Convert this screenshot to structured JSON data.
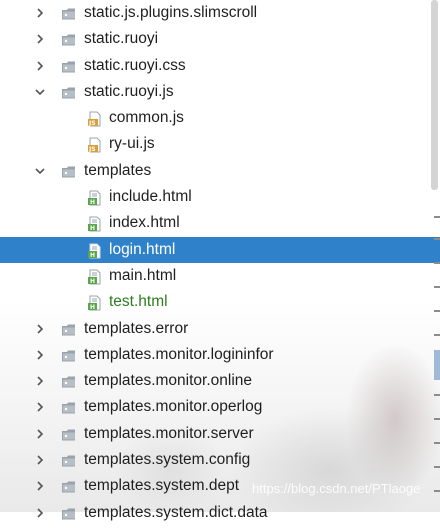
{
  "tree": {
    "rows": [
      {
        "label": "static.js.plugins.slimscroll",
        "type": "folder",
        "state": "collapsed"
      },
      {
        "label": "static.ruoyi",
        "type": "folder",
        "state": "collapsed"
      },
      {
        "label": "static.ruoyi.css",
        "type": "folder",
        "state": "collapsed"
      },
      {
        "label": "static.ruoyi.js",
        "type": "folder",
        "state": "expanded"
      },
      {
        "label": "common.js",
        "type": "js-file"
      },
      {
        "label": "ry-ui.js",
        "type": "js-file"
      },
      {
        "label": "templates",
        "type": "folder",
        "state": "expanded"
      },
      {
        "label": "include.html",
        "type": "html-file"
      },
      {
        "label": "index.html",
        "type": "html-file"
      },
      {
        "label": "login.html",
        "type": "html-file",
        "selected": true
      },
      {
        "label": "main.html",
        "type": "html-file"
      },
      {
        "label": "test.html",
        "type": "html-file",
        "status": "added"
      },
      {
        "label": "templates.error",
        "type": "folder",
        "state": "collapsed"
      },
      {
        "label": "templates.monitor.logininfor",
        "type": "folder",
        "state": "collapsed"
      },
      {
        "label": "templates.monitor.online",
        "type": "folder",
        "state": "collapsed"
      },
      {
        "label": "templates.monitor.operlog",
        "type": "folder",
        "state": "collapsed"
      },
      {
        "label": "templates.monitor.server",
        "type": "folder",
        "state": "collapsed"
      },
      {
        "label": "templates.system.config",
        "type": "folder",
        "state": "collapsed"
      },
      {
        "label": "templates.system.dept",
        "type": "folder",
        "state": "collapsed"
      },
      {
        "label": "templates.system.dict.data",
        "type": "folder",
        "state": "collapsed"
      }
    ]
  },
  "watermark": "https://blog.csdn.net/PTlaoge",
  "colors": {
    "selection": "#2f82c9",
    "folder": "#9aa3ab",
    "added_file_text": "#2e7d1d",
    "js_icon": "#d9a03a",
    "html_icon": "#5aa64b"
  }
}
